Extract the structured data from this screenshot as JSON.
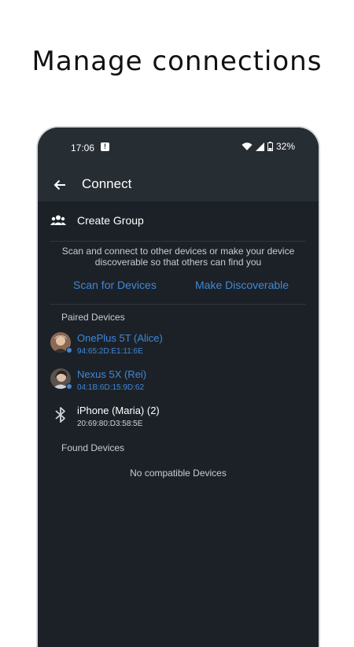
{
  "headline": "Manage connections",
  "status_bar": {
    "time": "17:06",
    "battery": "32%",
    "notification_icon": "message-alert-icon"
  },
  "app_bar": {
    "title": "Connect",
    "back_icon": "arrow-back-icon"
  },
  "create_group": {
    "label": "Create Group",
    "icon": "group-icon"
  },
  "description": "Scan and connect to other devices or make your device discoverable so that others can find you",
  "actions": {
    "scan": "Scan for Devices",
    "discoverable": "Make Discoverable"
  },
  "paired_section": {
    "title": "Paired Devices",
    "devices": [
      {
        "name": "OnePlus 5T (Alice)",
        "address": "94:65:2D:E1:11:6E",
        "connected": true,
        "icon": "avatar"
      },
      {
        "name": "Nexus 5X (Rei)",
        "address": "04:1B:6D:15:9D:62",
        "connected": true,
        "icon": "avatar"
      },
      {
        "name": "iPhone (Maria) (2)",
        "address": "20:69:80:D3:58:5E",
        "connected": false,
        "icon": "bluetooth-icon"
      }
    ]
  },
  "found_section": {
    "title": "Found Devices",
    "empty_text": "No compatible Devices"
  },
  "colors": {
    "background": "#1c2128",
    "appbar": "#262d33",
    "accent": "#3f88d6",
    "text": "#ffffff"
  }
}
